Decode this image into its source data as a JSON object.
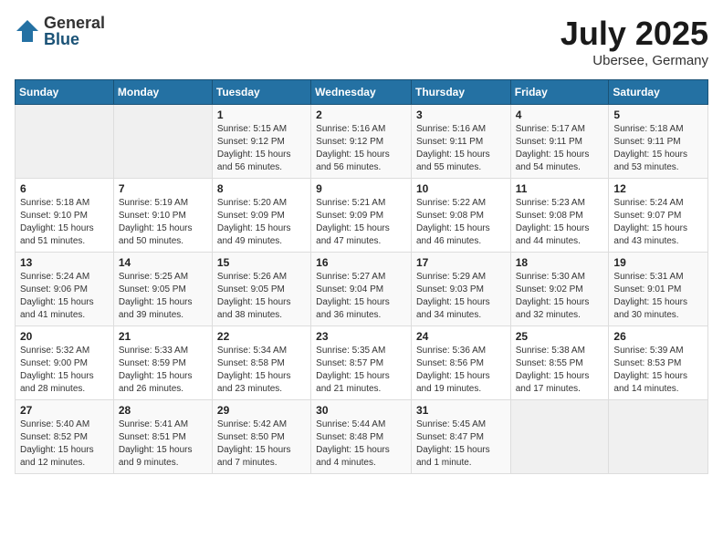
{
  "logo": {
    "general": "General",
    "blue": "Blue"
  },
  "title": "July 2025",
  "subtitle": "Ubersee, Germany",
  "days_header": [
    "Sunday",
    "Monday",
    "Tuesday",
    "Wednesday",
    "Thursday",
    "Friday",
    "Saturday"
  ],
  "weeks": [
    [
      {
        "day": "",
        "info": ""
      },
      {
        "day": "",
        "info": ""
      },
      {
        "day": "1",
        "info": "Sunrise: 5:15 AM\nSunset: 9:12 PM\nDaylight: 15 hours\nand 56 minutes."
      },
      {
        "day": "2",
        "info": "Sunrise: 5:16 AM\nSunset: 9:12 PM\nDaylight: 15 hours\nand 56 minutes."
      },
      {
        "day": "3",
        "info": "Sunrise: 5:16 AM\nSunset: 9:11 PM\nDaylight: 15 hours\nand 55 minutes."
      },
      {
        "day": "4",
        "info": "Sunrise: 5:17 AM\nSunset: 9:11 PM\nDaylight: 15 hours\nand 54 minutes."
      },
      {
        "day": "5",
        "info": "Sunrise: 5:18 AM\nSunset: 9:11 PM\nDaylight: 15 hours\nand 53 minutes."
      }
    ],
    [
      {
        "day": "6",
        "info": "Sunrise: 5:18 AM\nSunset: 9:10 PM\nDaylight: 15 hours\nand 51 minutes."
      },
      {
        "day": "7",
        "info": "Sunrise: 5:19 AM\nSunset: 9:10 PM\nDaylight: 15 hours\nand 50 minutes."
      },
      {
        "day": "8",
        "info": "Sunrise: 5:20 AM\nSunset: 9:09 PM\nDaylight: 15 hours\nand 49 minutes."
      },
      {
        "day": "9",
        "info": "Sunrise: 5:21 AM\nSunset: 9:09 PM\nDaylight: 15 hours\nand 47 minutes."
      },
      {
        "day": "10",
        "info": "Sunrise: 5:22 AM\nSunset: 9:08 PM\nDaylight: 15 hours\nand 46 minutes."
      },
      {
        "day": "11",
        "info": "Sunrise: 5:23 AM\nSunset: 9:08 PM\nDaylight: 15 hours\nand 44 minutes."
      },
      {
        "day": "12",
        "info": "Sunrise: 5:24 AM\nSunset: 9:07 PM\nDaylight: 15 hours\nand 43 minutes."
      }
    ],
    [
      {
        "day": "13",
        "info": "Sunrise: 5:24 AM\nSunset: 9:06 PM\nDaylight: 15 hours\nand 41 minutes."
      },
      {
        "day": "14",
        "info": "Sunrise: 5:25 AM\nSunset: 9:05 PM\nDaylight: 15 hours\nand 39 minutes."
      },
      {
        "day": "15",
        "info": "Sunrise: 5:26 AM\nSunset: 9:05 PM\nDaylight: 15 hours\nand 38 minutes."
      },
      {
        "day": "16",
        "info": "Sunrise: 5:27 AM\nSunset: 9:04 PM\nDaylight: 15 hours\nand 36 minutes."
      },
      {
        "day": "17",
        "info": "Sunrise: 5:29 AM\nSunset: 9:03 PM\nDaylight: 15 hours\nand 34 minutes."
      },
      {
        "day": "18",
        "info": "Sunrise: 5:30 AM\nSunset: 9:02 PM\nDaylight: 15 hours\nand 32 minutes."
      },
      {
        "day": "19",
        "info": "Sunrise: 5:31 AM\nSunset: 9:01 PM\nDaylight: 15 hours\nand 30 minutes."
      }
    ],
    [
      {
        "day": "20",
        "info": "Sunrise: 5:32 AM\nSunset: 9:00 PM\nDaylight: 15 hours\nand 28 minutes."
      },
      {
        "day": "21",
        "info": "Sunrise: 5:33 AM\nSunset: 8:59 PM\nDaylight: 15 hours\nand 26 minutes."
      },
      {
        "day": "22",
        "info": "Sunrise: 5:34 AM\nSunset: 8:58 PM\nDaylight: 15 hours\nand 23 minutes."
      },
      {
        "day": "23",
        "info": "Sunrise: 5:35 AM\nSunset: 8:57 PM\nDaylight: 15 hours\nand 21 minutes."
      },
      {
        "day": "24",
        "info": "Sunrise: 5:36 AM\nSunset: 8:56 PM\nDaylight: 15 hours\nand 19 minutes."
      },
      {
        "day": "25",
        "info": "Sunrise: 5:38 AM\nSunset: 8:55 PM\nDaylight: 15 hours\nand 17 minutes."
      },
      {
        "day": "26",
        "info": "Sunrise: 5:39 AM\nSunset: 8:53 PM\nDaylight: 15 hours\nand 14 minutes."
      }
    ],
    [
      {
        "day": "27",
        "info": "Sunrise: 5:40 AM\nSunset: 8:52 PM\nDaylight: 15 hours\nand 12 minutes."
      },
      {
        "day": "28",
        "info": "Sunrise: 5:41 AM\nSunset: 8:51 PM\nDaylight: 15 hours\nand 9 minutes."
      },
      {
        "day": "29",
        "info": "Sunrise: 5:42 AM\nSunset: 8:50 PM\nDaylight: 15 hours\nand 7 minutes."
      },
      {
        "day": "30",
        "info": "Sunrise: 5:44 AM\nSunset: 8:48 PM\nDaylight: 15 hours\nand 4 minutes."
      },
      {
        "day": "31",
        "info": "Sunrise: 5:45 AM\nSunset: 8:47 PM\nDaylight: 15 hours\nand 1 minute."
      },
      {
        "day": "",
        "info": ""
      },
      {
        "day": "",
        "info": ""
      }
    ]
  ]
}
